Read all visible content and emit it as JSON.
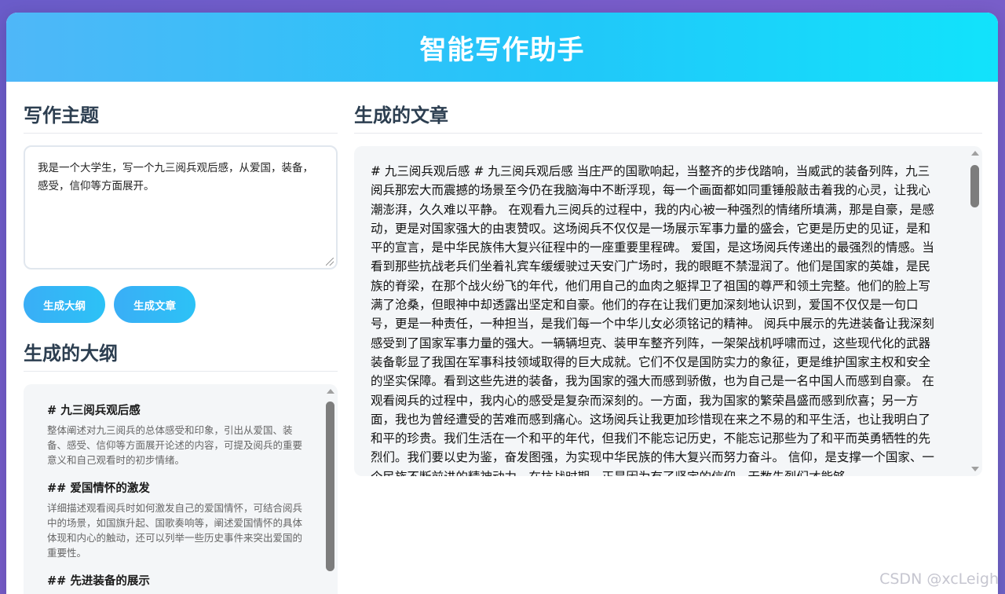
{
  "app": {
    "title": "智能写作助手"
  },
  "topic": {
    "title": "写作主题",
    "value": "我是一个大学生，写一个九三阅兵观后感，从爱国，装备，感受，信仰等方面展开。"
  },
  "buttons": {
    "outline": "生成大纲",
    "article": "生成文章"
  },
  "outline": {
    "title": "生成的大纲",
    "items": [
      {
        "heading": "# 九三阅兵观后感",
        "desc": "整体阐述对九三阅兵的总体感受和印象，引出从爱国、装备、感受、信仰等方面展开论述的内容，可提及阅兵的重要意义和自己观看时的初步情绪。"
      },
      {
        "heading": "## 爱国情怀的激发",
        "desc": "详细描述观看阅兵时如何激发自己的爱国情怀，可结合阅兵中的场景，如国旗升起、国歌奏响等，阐述爱国情怀的具体体现和内心的触动，还可以列举一些历史事件来突出爱国的重要性。"
      },
      {
        "heading": "## 先进装备的展示",
        "desc": ""
      }
    ]
  },
  "article": {
    "title": "生成的文章",
    "text": "# 九三阅兵观后感 # 九三阅兵观后感 当庄严的国歌响起，当整齐的步伐踏响，当威武的装备列阵，九三阅兵那宏大而震撼的场景至今仍在我脑海中不断浮现，每一个画面都如同重锤般敲击着我的心灵，让我心潮澎湃，久久难以平静。 在观看九三阅兵的过程中，我的内心被一种强烈的情绪所填满，那是自豪，是感动，更是对国家强大的由衷赞叹。这场阅兵不仅仅是一场展示军事力量的盛会，它更是历史的见证，是和平的宣言，是中华民族伟大复兴征程中的一座重要里程碑。 爱国，是这场阅兵传递出的最强烈的情感。当看到那些抗战老兵们坐着礼宾车缓缓驶过天安门广场时，我的眼眶不禁湿润了。他们是国家的英雄，是民族的脊梁，在那个战火纷飞的年代，他们用自己的血肉之躯捍卫了祖国的尊严和领土完整。他们的脸上写满了沧桑，但眼神中却透露出坚定和自豪。他们的存在让我们更加深刻地认识到，爱国不仅仅是一句口号，更是一种责任，一种担当，是我们每一个中华儿女必须铭记的精神。 阅兵中展示的先进装备让我深刻感受到了国家军事力量的强大。一辆辆坦克、装甲车整齐列阵，一架架战机呼啸而过，这些现代化的武器装备彰显了我国在军事科技领域取得的巨大成就。它们不仅是国防实力的象征，更是维护国家主权和安全的坚实保障。看到这些先进的装备，我为国家的强大而感到骄傲，也为自己是一名中国人而感到自豪。 在观看阅兵的过程中，我内心的感受是复杂而深刻的。一方面，我为国家的繁荣昌盛而感到欣喜；另一方面，我也为曾经遭受的苦难而感到痛心。这场阅兵让我更加珍惜现在来之不易的和平生活，也让我明白了和平的珍贵。我们生活在一个和平的年代，但我们不能忘记历史，不能忘记那些为了和平而英勇牺牲的先烈们。我们要以史为鉴，奋发图强，为实现中华民族的伟大复兴而努力奋斗。 信仰，是支撑一个国家、一个民族不断前进的精神动力。在抗战时期，正是因为有了坚定的信仰，无数先烈们才能够"
  },
  "watermark": "CSDN @xcLeigh"
}
